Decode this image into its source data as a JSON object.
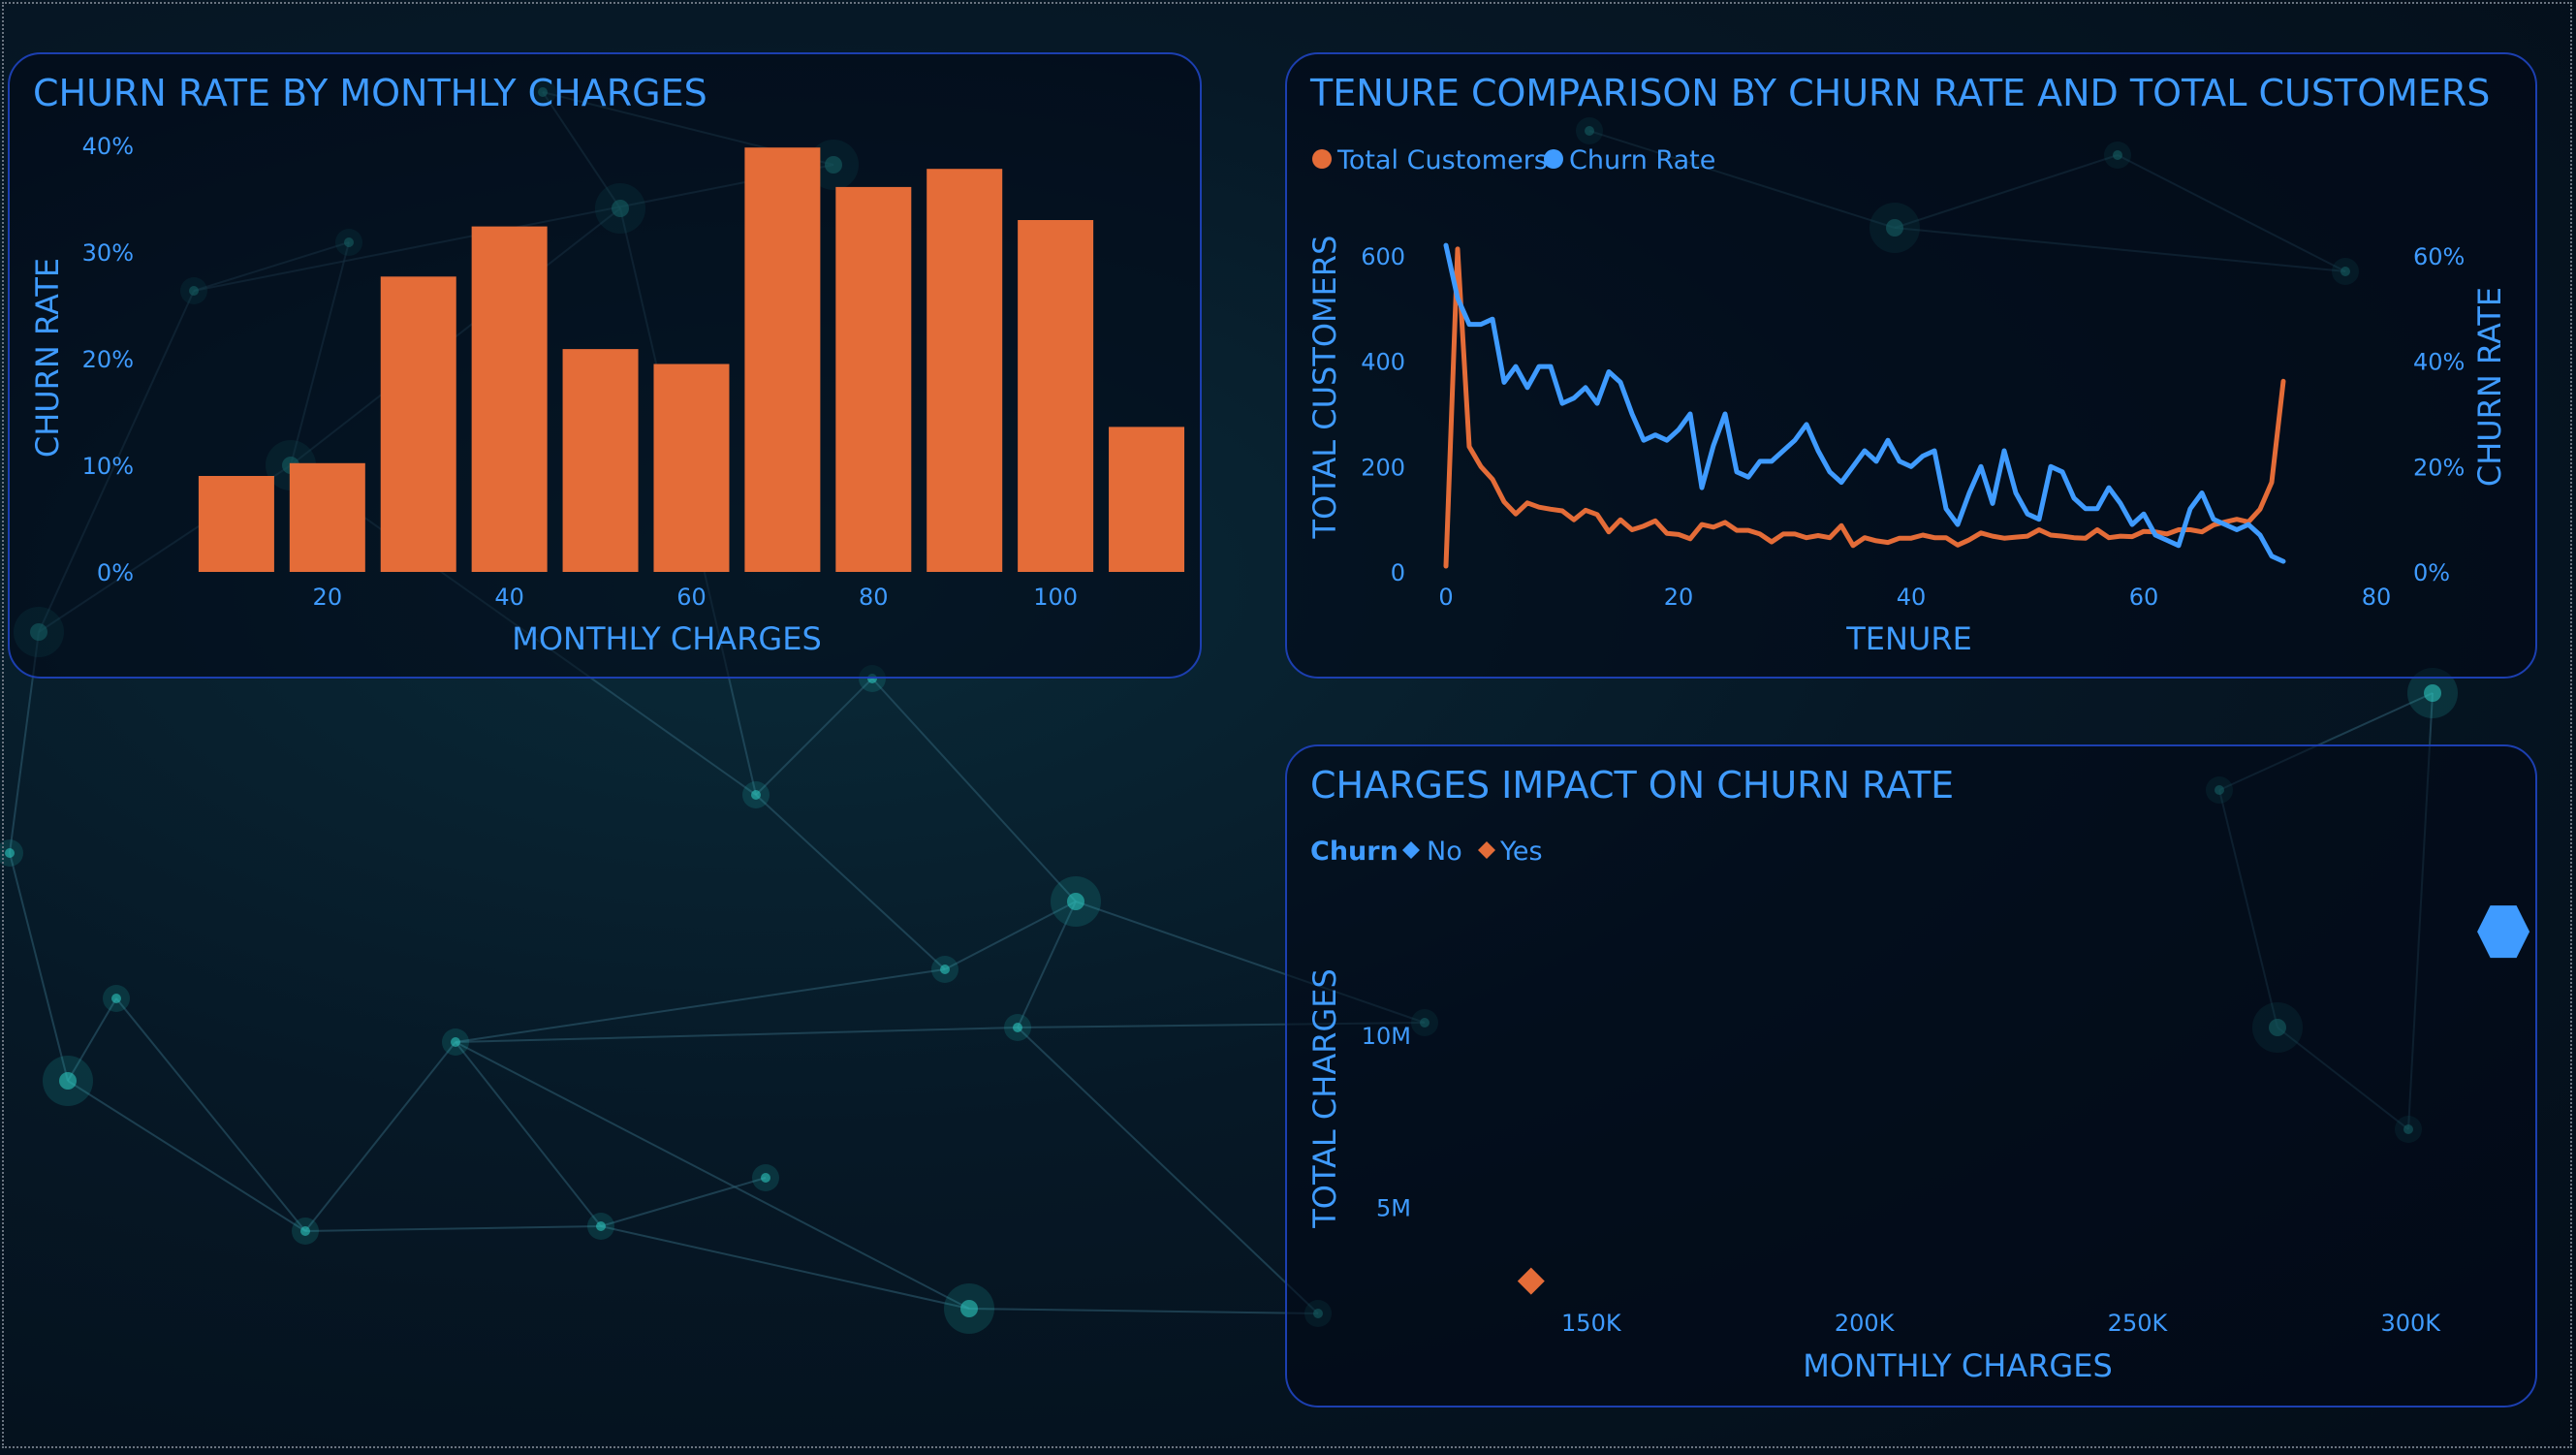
{
  "colors": {
    "orange": "#e46c38",
    "blue": "#3f9bff",
    "card_border": "#1c3fb0"
  },
  "charts": {
    "bar": {
      "title": "CHURN RATE BY MONTHLY CHARGES",
      "xlabel": "MONTHLY CHARGES",
      "ylabel": "CHURN RATE",
      "x_ticks": [
        "20",
        "40",
        "60",
        "80",
        "100"
      ],
      "y_ticks": [
        "0%",
        "10%",
        "20%",
        "30%",
        "40%"
      ]
    },
    "combo": {
      "title": "TENURE COMPARISON BY CHURN RATE AND TOTAL CUSTOMERS",
      "legend": [
        "Total Customers",
        "Churn Rate"
      ],
      "xlabel": "TENURE",
      "ylabel_left": "TOTAL CUSTOMERS",
      "ylabel_right": "CHURN RATE",
      "x_ticks": [
        "0",
        "20",
        "40",
        "60",
        "80"
      ],
      "y_left_ticks": [
        "0",
        "200",
        "400",
        "600"
      ],
      "y_right_ticks": [
        "0%",
        "20%",
        "40%",
        "60%"
      ]
    },
    "scatter": {
      "title": "CHARGES IMPACT ON CHURN RATE",
      "legend_title": "Churn",
      "legend": [
        "No",
        "Yes"
      ],
      "xlabel": "MONTHLY CHARGES",
      "ylabel": "TOTAL CHARGES",
      "x_ticks": [
        "150K",
        "200K",
        "250K",
        "300K"
      ],
      "y_ticks": [
        "5M",
        "10M"
      ]
    }
  },
  "chart_data": [
    {
      "type": "bar",
      "title": "CHURN RATE BY MONTHLY CHARGES",
      "xlabel": "MONTHLY CHARGES",
      "ylabel": "CHURN RATE",
      "x": [
        10,
        20,
        30,
        40,
        50,
        60,
        70,
        80,
        90,
        100,
        110
      ],
      "values": [
        0.09,
        0.102,
        0.277,
        0.324,
        0.209,
        0.195,
        0.398,
        0.361,
        0.378,
        0.33,
        0.136
      ],
      "xlim": [
        0,
        115
      ],
      "ylim": [
        0,
        0.4
      ],
      "color": "#e46c38"
    },
    {
      "type": "line",
      "title": "TENURE COMPARISON BY CHURN RATE AND TOTAL CUSTOMERS",
      "xlabel": "TENURE",
      "ylabel": "TOTAL CUSTOMERS",
      "y2label": "CHURN RATE",
      "xlim": [
        0,
        80
      ],
      "ylim": [
        0,
        600
      ],
      "y2lim": [
        0,
        0.6
      ],
      "x": [
        0,
        1,
        2,
        3,
        4,
        5,
        6,
        7,
        8,
        9,
        10,
        11,
        12,
        13,
        14,
        15,
        16,
        17,
        18,
        19,
        20,
        21,
        22,
        23,
        24,
        25,
        26,
        27,
        28,
        29,
        30,
        31,
        32,
        33,
        34,
        35,
        36,
        37,
        38,
        39,
        40,
        41,
        42,
        43,
        44,
        45,
        46,
        47,
        48,
        49,
        50,
        51,
        52,
        53,
        54,
        55,
        56,
        57,
        58,
        59,
        60,
        61,
        62,
        63,
        64,
        65,
        66,
        67,
        68,
        69,
        70,
        71,
        72
      ],
      "series": [
        {
          "name": "Total Customers",
          "axis": "left",
          "color": "#e46c38",
          "values": [
            11,
            613,
            238,
            200,
            176,
            133,
            110,
            131,
            123,
            119,
            116,
            99,
            117,
            109,
            76,
            99,
            80,
            87,
            97,
            73,
            71,
            63,
            90,
            85,
            94,
            79,
            79,
            72,
            57,
            72,
            72,
            65,
            69,
            65,
            88,
            50,
            65,
            59,
            56,
            64,
            64,
            70,
            65,
            65,
            51,
            61,
            74,
            68,
            64,
            66,
            68,
            80,
            70,
            68,
            65,
            64,
            80,
            65,
            68,
            67,
            77,
            76,
            72,
            80,
            80,
            76,
            89,
            95,
            100,
            95,
            119,
            170,
            362
          ]
        },
        {
          "name": "Churn Rate",
          "axis": "right",
          "color": "#3f9bff",
          "values": [
            0.62,
            0.52,
            0.47,
            0.47,
            0.48,
            0.36,
            0.39,
            0.35,
            0.39,
            0.39,
            0.32,
            0.33,
            0.35,
            0.32,
            0.38,
            0.36,
            0.3,
            0.25,
            0.26,
            0.25,
            0.27,
            0.3,
            0.16,
            0.24,
            0.3,
            0.19,
            0.18,
            0.21,
            0.21,
            0.23,
            0.25,
            0.28,
            0.23,
            0.19,
            0.17,
            0.2,
            0.23,
            0.21,
            0.25,
            0.21,
            0.2,
            0.22,
            0.23,
            0.12,
            0.09,
            0.15,
            0.2,
            0.13,
            0.23,
            0.15,
            0.11,
            0.1,
            0.2,
            0.19,
            0.14,
            0.12,
            0.12,
            0.16,
            0.13,
            0.09,
            0.11,
            0.07,
            0.06,
            0.05,
            0.12,
            0.15,
            0.1,
            0.09,
            0.08,
            0.09,
            0.07,
            0.03,
            0.02
          ]
        }
      ]
    },
    {
      "type": "scatter",
      "title": "CHARGES IMPACT ON CHURN RATE",
      "xlabel": "MONTHLY CHARGES",
      "ylabel": "TOTAL CHARGES",
      "xlim": [
        100000,
        320000
      ],
      "ylim": [
        1500000,
        15000000
      ],
      "series": [
        {
          "name": "No",
          "color": "#3f9bff",
          "points": [
            [
              317000,
              13000000
            ]
          ]
        },
        {
          "name": "Yes",
          "color": "#e46c38",
          "points": [
            [
              139000,
              2860000
            ]
          ]
        }
      ]
    }
  ]
}
